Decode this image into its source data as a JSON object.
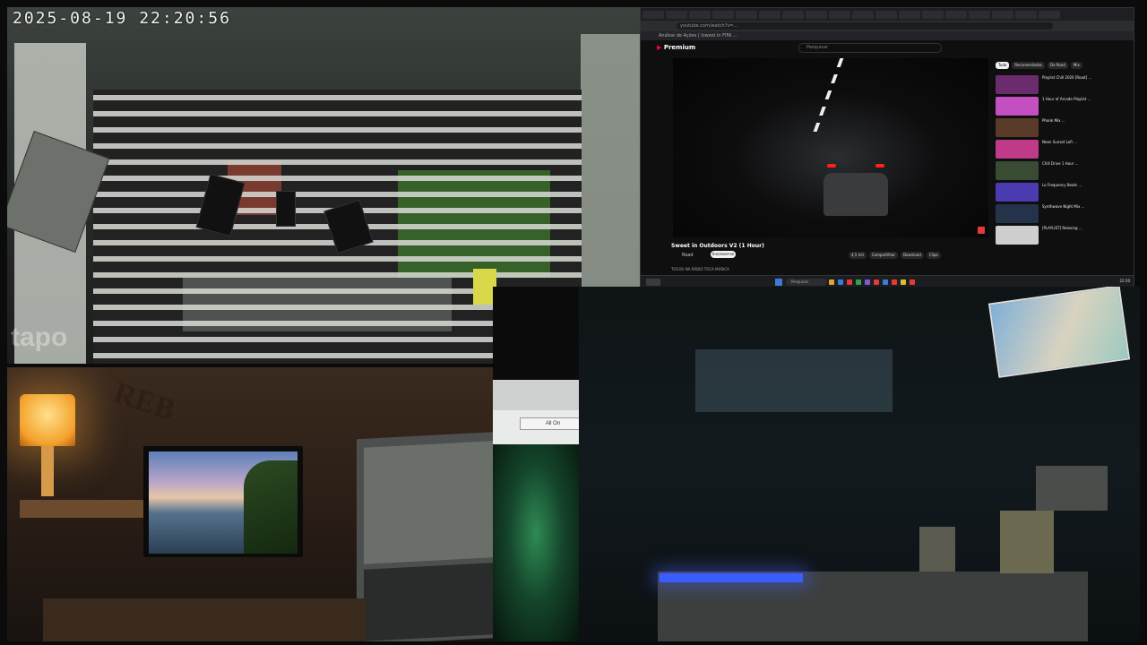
{
  "camera_feed": {
    "timestamp": "2025-08-19  22:20:56",
    "watermark": "tapo"
  },
  "browser": {
    "address": "youtube.com/watch?v=...",
    "bookmarks": "Análise de Ações   |   lowest in FIFA ...",
    "youtube": {
      "logo": "Premium",
      "search_placeholder": "Pesquisar",
      "video_title": "Sweet in Outdoors V2 (1 Hour)",
      "channel": "Road",
      "subscribe_label": "Inscrever-se",
      "actions": [
        "4,5 mil",
        "Compartilhar",
        "Download",
        "Clipe"
      ],
      "description": "TOCOU NA RÁDIO TOCA MÚSICA",
      "chips": [
        "Tudo",
        "Recomendados",
        "Do Road",
        "Mix"
      ],
      "recommendations": [
        {
          "title": "Playlist Chill 2020 [Road] ...",
          "color": "#6b2c6e"
        },
        {
          "title": "1 Hour of Arcade Playlist ...",
          "color": "#c34fc0"
        },
        {
          "title": "Phonk Mix ...",
          "color": "#5a3b2a"
        },
        {
          "title": "Neon Sunset Lofi ...",
          "color": "#c03a8a"
        },
        {
          "title": "Chill Drive 1 Hour ...",
          "color": "#3a4b33"
        },
        {
          "title": "Lo Frequency Beats ...",
          "color": "#4a3bb0"
        },
        {
          "title": "Synthwave Night Mix ...",
          "color": "#24324a"
        },
        {
          "title": "[PLAYLIST] Relaxing ...",
          "color": "#cfcfcf"
        }
      ]
    },
    "taskbar": {
      "search_placeholder": "Pesquisar",
      "clock": "22:20"
    }
  },
  "popup": {
    "all_on_label": "All On"
  },
  "room_a": {
    "poster_text": "REB"
  }
}
